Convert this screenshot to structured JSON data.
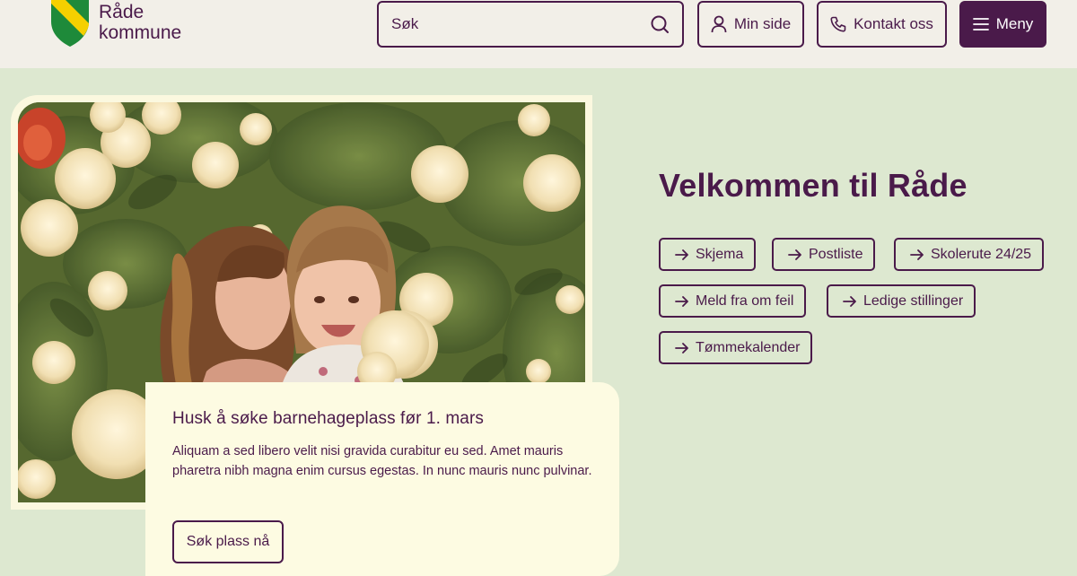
{
  "header": {
    "logo": {
      "line1": "Råde",
      "line2": "kommune",
      "colors": {
        "yellow": "#f5d000",
        "green": "#1e8a3a"
      }
    },
    "search": {
      "placeholder": "Søk"
    },
    "buttons": {
      "min_side": "Min side",
      "kontakt": "Kontakt oss",
      "meny": "Meny"
    }
  },
  "hero": {
    "card": {
      "title": "Husk å søke barnehageplass før 1. mars",
      "text": "Aliquam a sed libero velit nisi gravida curabitur eu sed. Amet mauris pharetra nibh magna enim cursus egestas. In nunc mauris nunc pulvinar.",
      "cta": "Søk plass nå"
    }
  },
  "main": {
    "welcome": "Velkommen til Råde",
    "quicklinks": [
      "Skjema",
      "Postliste",
      "Skolerute 24/25",
      "Meld fra om feil",
      "Ledige stillinger",
      "Tømmekalender"
    ]
  },
  "colors": {
    "brand": "#4a1a4a",
    "background": "#dde8d0",
    "header": "#f2efe8",
    "card": "#fdfbe2"
  }
}
